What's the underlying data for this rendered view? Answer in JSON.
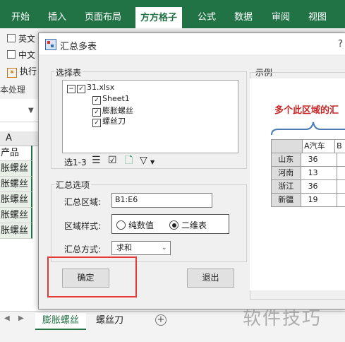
{
  "ribbon": {
    "tabs": [
      "开始",
      "插入",
      "页面布局",
      "方方格子",
      "公式",
      "数据",
      "审阅",
      "视图"
    ],
    "active_tab": "方方格子",
    "row1_label": "英文",
    "row2_label": "中文",
    "row3_label": "执行",
    "group_label": "本处理"
  },
  "sheet": {
    "column_header": "A",
    "cells": [
      "产品",
      "胀螺丝",
      "胀螺丝",
      "胀螺丝",
      "胀螺丝",
      "胀螺丝"
    ],
    "tabs": [
      "膨胀螺丝",
      "螺丝刀"
    ],
    "active_tab": "膨胀螺丝",
    "add_tab": "+"
  },
  "dialog": {
    "title": "汇总多表",
    "help_glyph": "?",
    "select_tables": {
      "label": "选择表",
      "tree": {
        "root": "31.xlsx",
        "children": [
          "Sheet1",
          "膨胀螺丝",
          "螺丝刀"
        ]
      },
      "toolbar_label": "选1-3"
    },
    "options": {
      "label": "汇总选项",
      "range_label": "汇总区域:",
      "range_value": "B1:E6",
      "style_label": "区域样式:",
      "style_options": [
        "纯数值",
        "二维表"
      ],
      "style_selected": "二维表",
      "method_label": "汇总方式:",
      "method_value": "求和"
    },
    "ok_label": "确定",
    "exit_label": "退出",
    "example": {
      "label": "示例",
      "caption": "多个此区域的汇",
      "table": {
        "header": [
          "",
          "A汽车",
          "B"
        ],
        "rows": [
          [
            "山东",
            "36",
            ""
          ],
          [
            "河南",
            "13",
            ""
          ],
          [
            "浙江",
            "36",
            ""
          ],
          [
            "新疆",
            "19",
            ""
          ]
        ]
      }
    }
  },
  "watermark": "软件技巧",
  "colors": {
    "ribbon": "#217346",
    "highlight": "#e53935",
    "caption": "#c62828",
    "brace": "#4a7ab5"
  }
}
